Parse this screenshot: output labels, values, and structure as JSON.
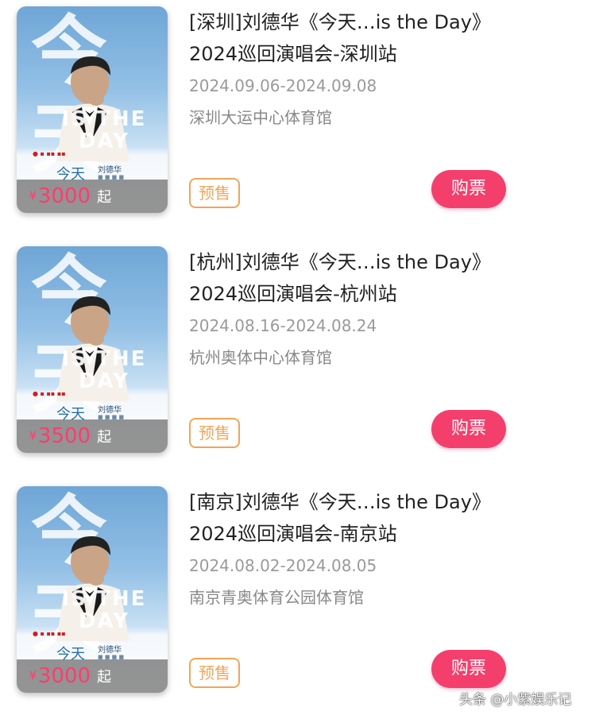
{
  "events": [
    {
      "title_line1": "[深圳]刘德华《今天…is the Day》",
      "title_line2": "2024巡回演唱会-深圳站",
      "dates": "2024.09.06-2024.09.08",
      "venue": "深圳大运中心体育馆",
      "price_symbol": "¥",
      "price": "3000",
      "price_suffix": "起",
      "tag": "预售",
      "buy_label": "购票",
      "poster": {
        "big_title": "今天",
        "line1": "IS THE",
        "line2": "DAY",
        "sub_title": "今天",
        "artist": "刘德华"
      }
    },
    {
      "title_line1": "[杭州]刘德华《今天…is the Day》",
      "title_line2": "2024巡回演唱会-杭州站",
      "dates": "2024.08.16-2024.08.24",
      "venue": "杭州奥体中心体育馆",
      "price_symbol": "¥",
      "price": "3500",
      "price_suffix": "起",
      "tag": "预售",
      "buy_label": "购票",
      "poster": {
        "big_title": "今天",
        "line1": "IS THE",
        "line2": "DAY",
        "sub_title": "今天",
        "artist": "刘德华"
      }
    },
    {
      "title_line1": "[南京]刘德华《今天…is the Day》",
      "title_line2": "2024巡回演唱会-南京站",
      "dates": "2024.08.02-2024.08.05",
      "venue": "南京青奥体育公园体育馆",
      "price_symbol": "¥",
      "price": "3000",
      "price_suffix": "起",
      "tag": "预售",
      "buy_label": "购票",
      "poster": {
        "big_title": "今天",
        "line1": "IS THE",
        "line2": "DAY",
        "sub_title": "今天",
        "artist": "刘德华"
      }
    }
  ],
  "watermark": "头条 @小紫娱乐记",
  "colors": {
    "buy_button": "#f43f6c",
    "presale_tag": "#f0a55a",
    "price": "#ff3c6c",
    "poster_sky": "#6fa6d6"
  }
}
